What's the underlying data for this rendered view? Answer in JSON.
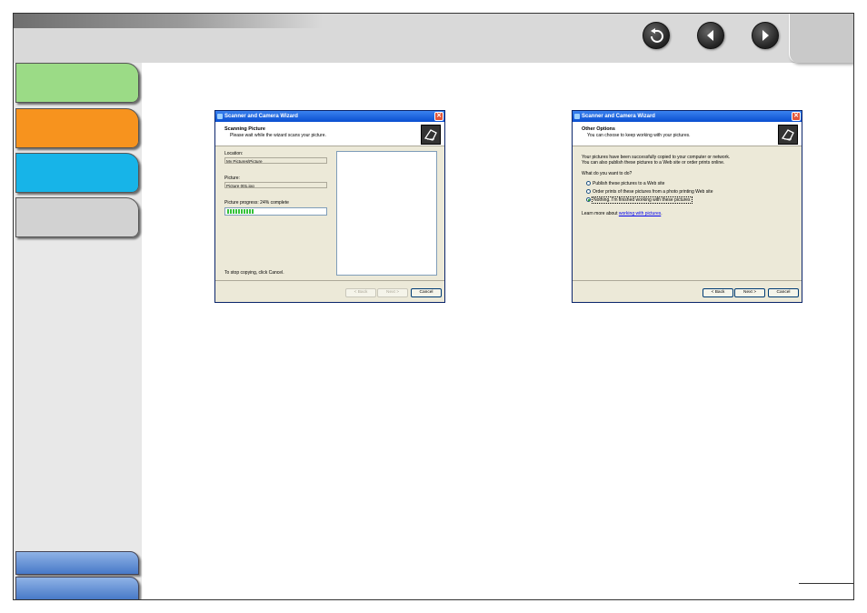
{
  "nav": {
    "back_icon": "back-arrow-icon",
    "previous_icon": "left-arrow-icon",
    "next_icon": "right-arrow-icon"
  },
  "sidebar": {
    "tabs": [
      {
        "color": "#9bdb86"
      },
      {
        "color": "#f7931e"
      },
      {
        "color": "#17b4e8"
      },
      {
        "color": "#d2d2d2"
      }
    ]
  },
  "dialog_scanning": {
    "title": "Scanner and Camera Wizard",
    "header_title": "Scanning Picture",
    "header_subtitle": "Please wait while the wizard scans your picture.",
    "location_label": "Location:",
    "location_value": "My Pictures\\Picture",
    "picture_label": "Picture:",
    "picture_value": "Picture 001.jpg",
    "progress_label": "Picture progress: 24% complete",
    "progress_fraction": 0.24,
    "stop_text": "To stop copying, click Cancel.",
    "back_label": "< Back",
    "next_label": "Next >",
    "cancel_label": "Cancel"
  },
  "dialog_options": {
    "title": "Scanner and Camera Wizard",
    "header_title": "Other Options",
    "header_subtitle": "You can choose to keep working with your pictures.",
    "body_line1": "Your pictures have been successfully copied to your computer or network.",
    "body_line2": "You can also publish these pictures to a Web site or order prints online.",
    "question": "What do you want to do?",
    "options": [
      {
        "label": "Publish these pictures to a Web site",
        "selected": false
      },
      {
        "label": "Order prints of these pictures from a photo printing Web site",
        "selected": false
      },
      {
        "label": "Nothing. I'm finished working with these pictures",
        "selected": true
      }
    ],
    "learn_prefix": "Learn more about",
    "learn_link": "working with pictures",
    "learn_suffix": ".",
    "back_label": "< Back",
    "next_label": "Next >",
    "cancel_label": "Cancel"
  }
}
